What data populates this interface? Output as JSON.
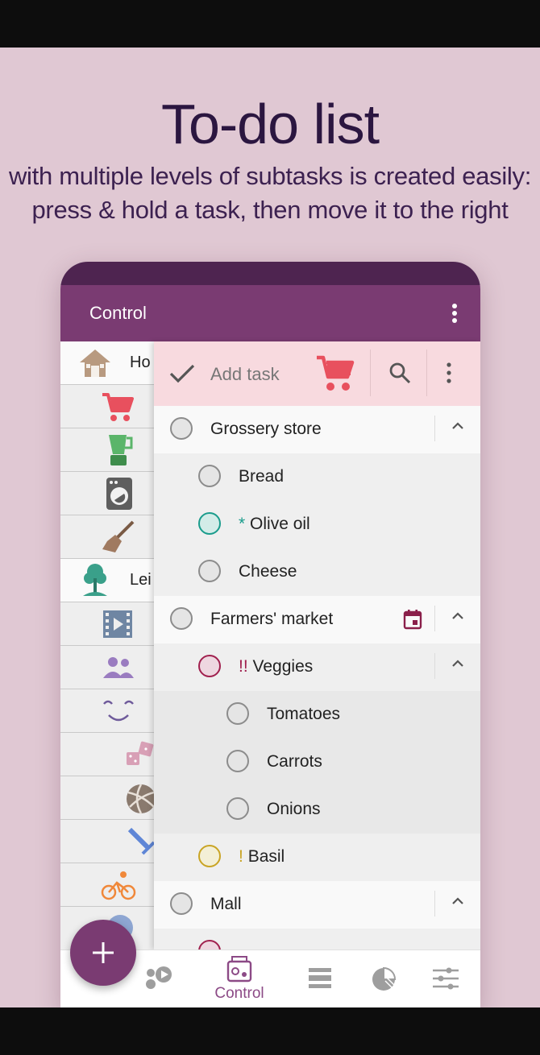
{
  "headline": {
    "title": "To-do list",
    "subtitle_line1": "with multiple levels of subtasks is created easily:",
    "subtitle_line2": "press & hold a task, then move it to the right"
  },
  "appbar": {
    "title": "Control",
    "menu_icon": "more-vert-icon"
  },
  "categories": [
    {
      "icon": "house-icon",
      "label": "Ho"
    },
    {
      "icon": "cart-icon",
      "label": ""
    },
    {
      "icon": "blender-icon",
      "label": ""
    },
    {
      "icon": "washing-machine-icon",
      "label": ""
    },
    {
      "icon": "broom-icon",
      "label": ""
    },
    {
      "icon": "tree-icon",
      "label": "Lei"
    },
    {
      "icon": "film-icon",
      "label": ""
    },
    {
      "icon": "people-icon",
      "label": ""
    },
    {
      "icon": "smile-icon",
      "label": ""
    },
    {
      "icon": "dice-icon",
      "label": ""
    },
    {
      "icon": "volleyball-icon",
      "label": ""
    },
    {
      "icon": "sword-icon",
      "label": ""
    },
    {
      "icon": "bicycle-icon",
      "label": ""
    }
  ],
  "addbar": {
    "placeholder": "Add task",
    "check_icon": "check-icon",
    "cart_icon": "cart-icon",
    "search_icon": "search-icon",
    "more_icon": "more-vert-icon"
  },
  "tasks": [
    {
      "label": "Grossery store",
      "mark": "",
      "level": 0,
      "expand": true
    },
    {
      "label": "Bread",
      "mark": "",
      "level": 1
    },
    {
      "label": "Olive oil",
      "mark": "*",
      "level": 1,
      "color": "#1a9c8c"
    },
    {
      "label": "Cheese",
      "mark": "",
      "level": 1
    },
    {
      "label": "Farmers' market",
      "mark": "",
      "level": 0,
      "expand": true,
      "calendar": true
    },
    {
      "label": "Veggies",
      "mark": "!!",
      "level": 1,
      "expand": true,
      "color": "#a0204e"
    },
    {
      "label": "Tomatoes",
      "mark": "",
      "level": 2
    },
    {
      "label": "Carrots",
      "mark": "",
      "level": 2
    },
    {
      "label": "Onions",
      "mark": "",
      "level": 2
    },
    {
      "label": "Basil",
      "mark": "!",
      "level": 1,
      "color": "#c9a424"
    },
    {
      "label": "Mall",
      "mark": "",
      "level": 0,
      "expand": true
    }
  ],
  "nav": [
    {
      "icon": "bubbles-play-icon",
      "label": ""
    },
    {
      "icon": "control-icon",
      "label": "Control",
      "active": true
    },
    {
      "icon": "list-icon",
      "label": ""
    },
    {
      "icon": "pie-icon",
      "label": ""
    },
    {
      "icon": "sliders-icon",
      "label": ""
    }
  ],
  "fab": {
    "icon": "plus-icon"
  },
  "colors": {
    "primary": "#7a3b72",
    "primary_dark": "#4e2450",
    "background": "#e0c8d3",
    "addbar": "#f8dadf"
  }
}
